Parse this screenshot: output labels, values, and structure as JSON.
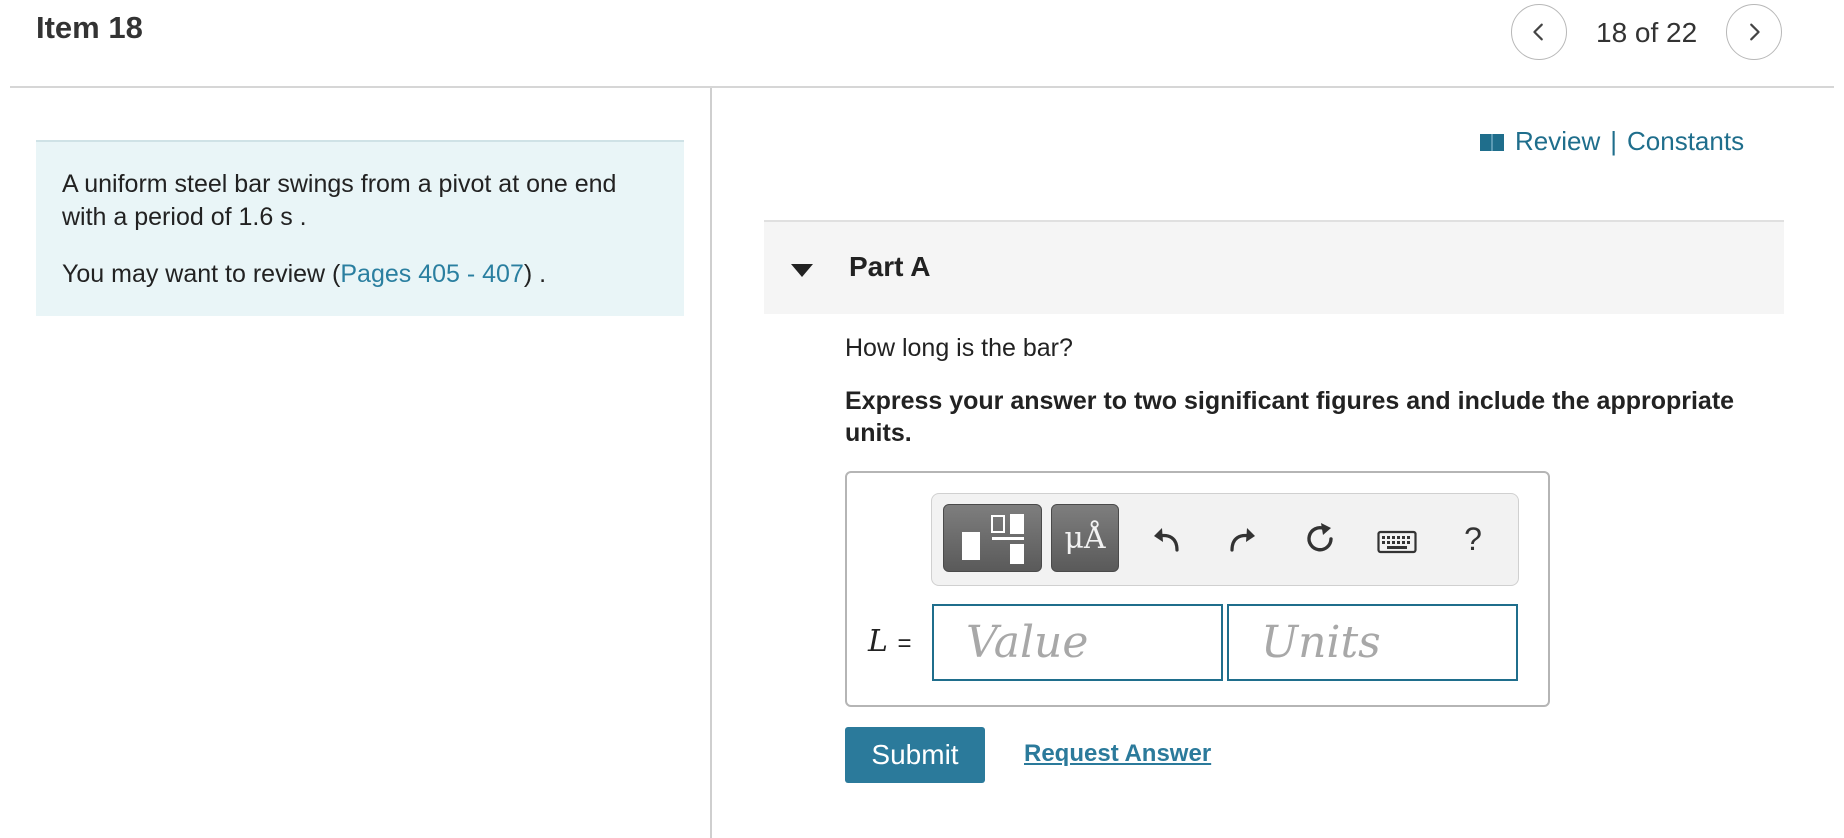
{
  "header": {
    "item_title": "Item 18",
    "pager_text": "18 of 22"
  },
  "intro": {
    "line1": "A uniform steel bar swings from a pivot at one end with a period of 1.6 s .",
    "review_prefix": "You may want to review (",
    "review_link": "Pages 405 - 407",
    "review_suffix": ") ."
  },
  "resources": {
    "review": "Review",
    "separator": "|",
    "constants": "Constants"
  },
  "part": {
    "title": "Part A",
    "question": "How long is the bar?",
    "instruction": "Express your answer to two significant figures and include the appropriate units."
  },
  "answer": {
    "variable": "L",
    "equals": "=",
    "units_tool_label": "μÅ",
    "help_label": "?",
    "value_placeholder": "Value",
    "units_placeholder": "Units"
  },
  "actions": {
    "submit": "Submit",
    "request_answer": "Request Answer"
  },
  "colors": {
    "accent": "#2b7a9b",
    "intro_bg": "#e9f5f7"
  }
}
